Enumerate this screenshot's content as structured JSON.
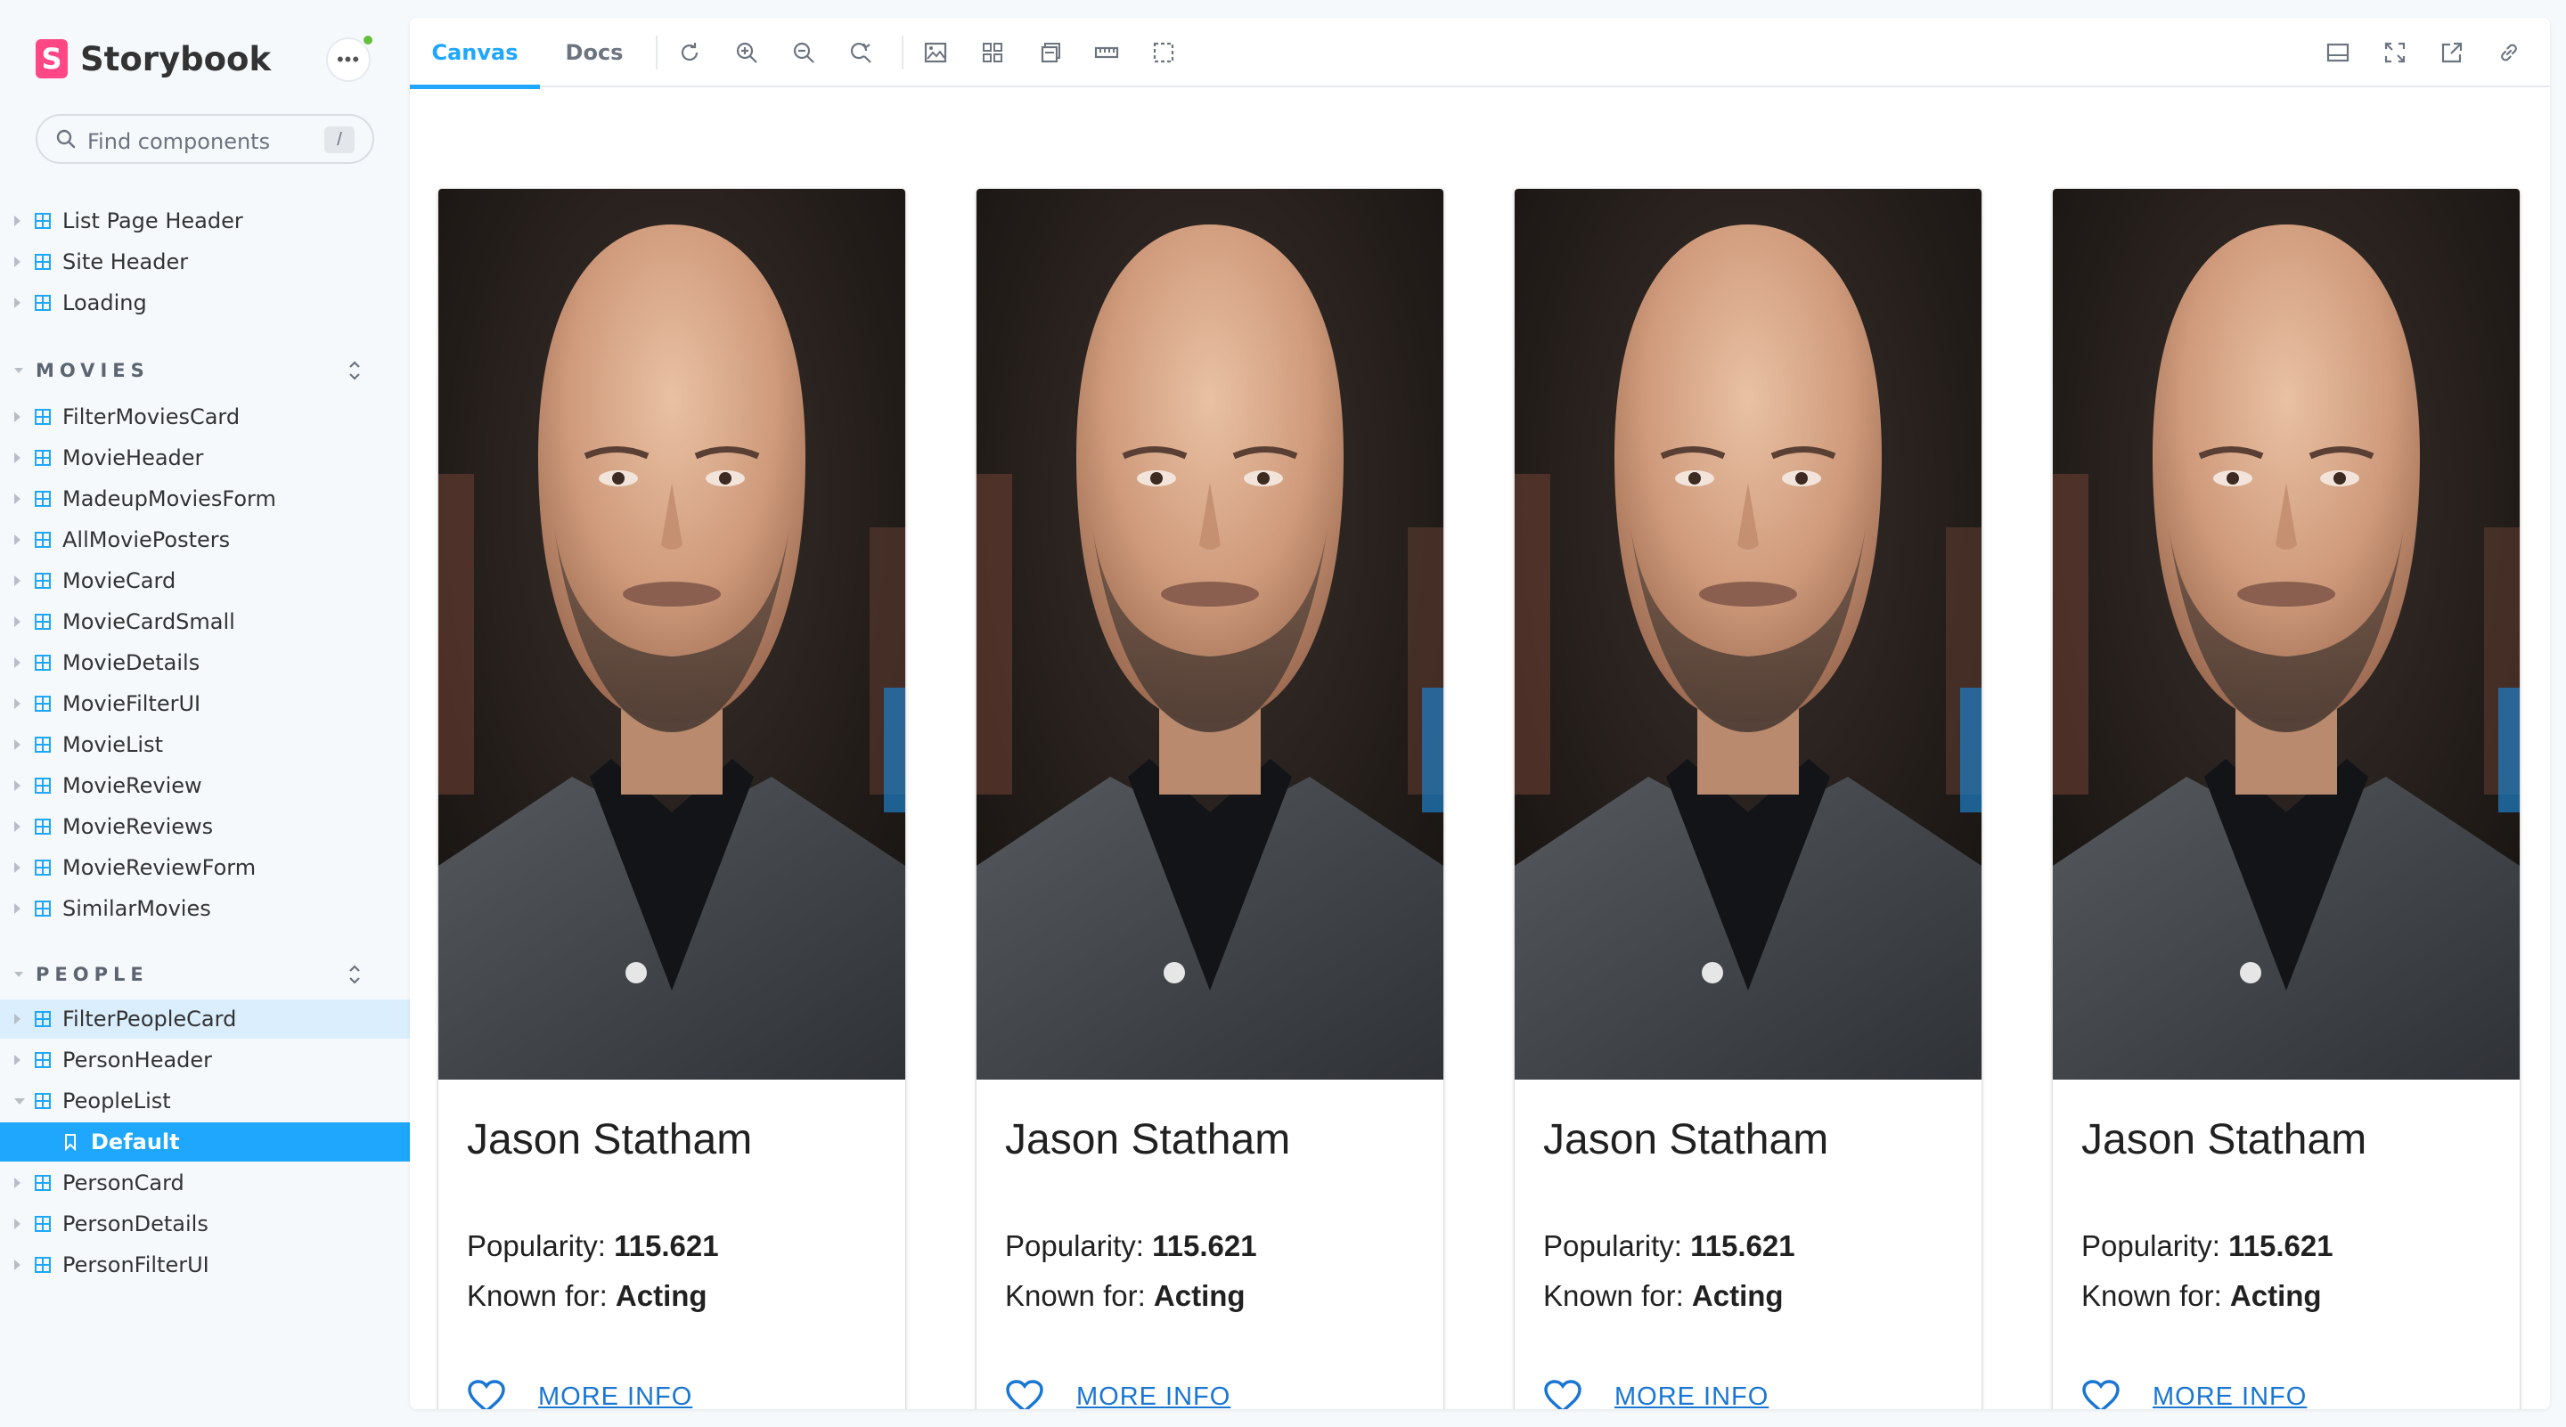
{
  "app": {
    "brand": "Storybook",
    "menu_icon": "ellipsis-icon",
    "status_color": "#66bf3c",
    "accent": "#1ea7fd"
  },
  "search": {
    "placeholder": "Find components",
    "shortcut": "/"
  },
  "sidebar": {
    "top_items": [
      {
        "label": "List Page Header"
      },
      {
        "label": "Site Header"
      },
      {
        "label": "Loading"
      }
    ],
    "movies": {
      "title": "MOVIES",
      "items": [
        {
          "label": "FilterMoviesCard"
        },
        {
          "label": "MovieHeader"
        },
        {
          "label": "MadeupMoviesForm"
        },
        {
          "label": "AllMoviePosters"
        },
        {
          "label": "MovieCard"
        },
        {
          "label": "MovieCardSmall"
        },
        {
          "label": "MovieDetails"
        },
        {
          "label": "MovieFilterUI"
        },
        {
          "label": "MovieList"
        },
        {
          "label": "MovieReview"
        },
        {
          "label": "MovieReviews"
        },
        {
          "label": "MovieReviewForm"
        },
        {
          "label": "SimilarMovies"
        }
      ]
    },
    "people": {
      "title": "PEOPLE",
      "items": [
        {
          "label": "FilterPeopleCard"
        },
        {
          "label": "PersonHeader"
        },
        {
          "label": "PeopleList"
        },
        {
          "label": "Default"
        },
        {
          "label": "PersonCard"
        },
        {
          "label": "PersonDetails"
        },
        {
          "label": "PersonFilterUI"
        }
      ]
    }
  },
  "toolbar": {
    "tabs": [
      {
        "label": "Canvas"
      },
      {
        "label": "Docs"
      }
    ],
    "left_icons": [
      "reload-icon",
      "zoom-in-icon",
      "zoom-out-icon",
      "zoom-reset-icon",
      "background-icon",
      "grid-icon",
      "viewport-icon",
      "measure-icon",
      "outline-icon"
    ],
    "right_icons": [
      "panel-icon",
      "fullscreen-icon",
      "open-new-tab-icon",
      "copy-link-icon"
    ]
  },
  "cards": [
    {
      "name": "Jason Statham",
      "popularity_label": "Popularity: ",
      "popularity": "115.621",
      "known_label": "Known for: ",
      "known_for": "Acting",
      "link": "MORE INFO"
    },
    {
      "name": "Jason Statham",
      "popularity_label": "Popularity: ",
      "popularity": "115.621",
      "known_label": "Known for: ",
      "known_for": "Acting",
      "link": "MORE INFO"
    },
    {
      "name": "Jason Statham",
      "popularity_label": "Popularity: ",
      "popularity": "115.621",
      "known_label": "Known for: ",
      "known_for": "Acting",
      "link": "MORE INFO"
    },
    {
      "name": "Jason Statham",
      "popularity_label": "Popularity: ",
      "popularity": "115.621",
      "known_label": "Known for: ",
      "known_for": "Acting",
      "link": "MORE INFO"
    }
  ],
  "colors": {
    "link": "#1976d2",
    "selected_row": "#1ea7fd",
    "highlight_row": "#dbeefe"
  }
}
